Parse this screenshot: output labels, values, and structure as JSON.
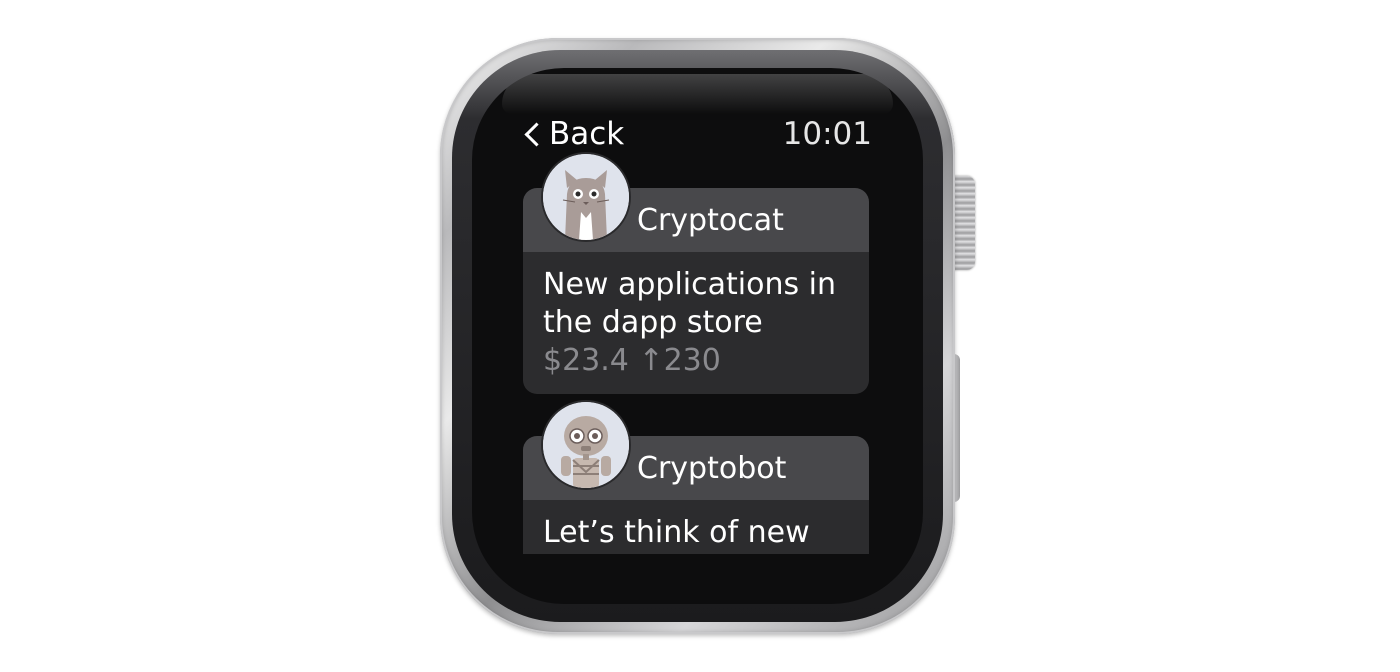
{
  "status_bar": {
    "back_label": "Back",
    "time": "10:01"
  },
  "feed": {
    "items": [
      {
        "author": "Cryptocat",
        "avatar_icon": "cat-avatar-icon",
        "message": "New applications in the dapp store",
        "price": "$23.4",
        "votes": "↑230"
      },
      {
        "author": "Cryptobot",
        "avatar_icon": "robot-avatar-icon",
        "message": "Let’s think of new"
      }
    ]
  },
  "colors": {
    "screen_background": "#0d0d0e",
    "card_header": "#48484b",
    "card_body": "#2c2c2e",
    "meta_text": "#8a8a8e"
  }
}
